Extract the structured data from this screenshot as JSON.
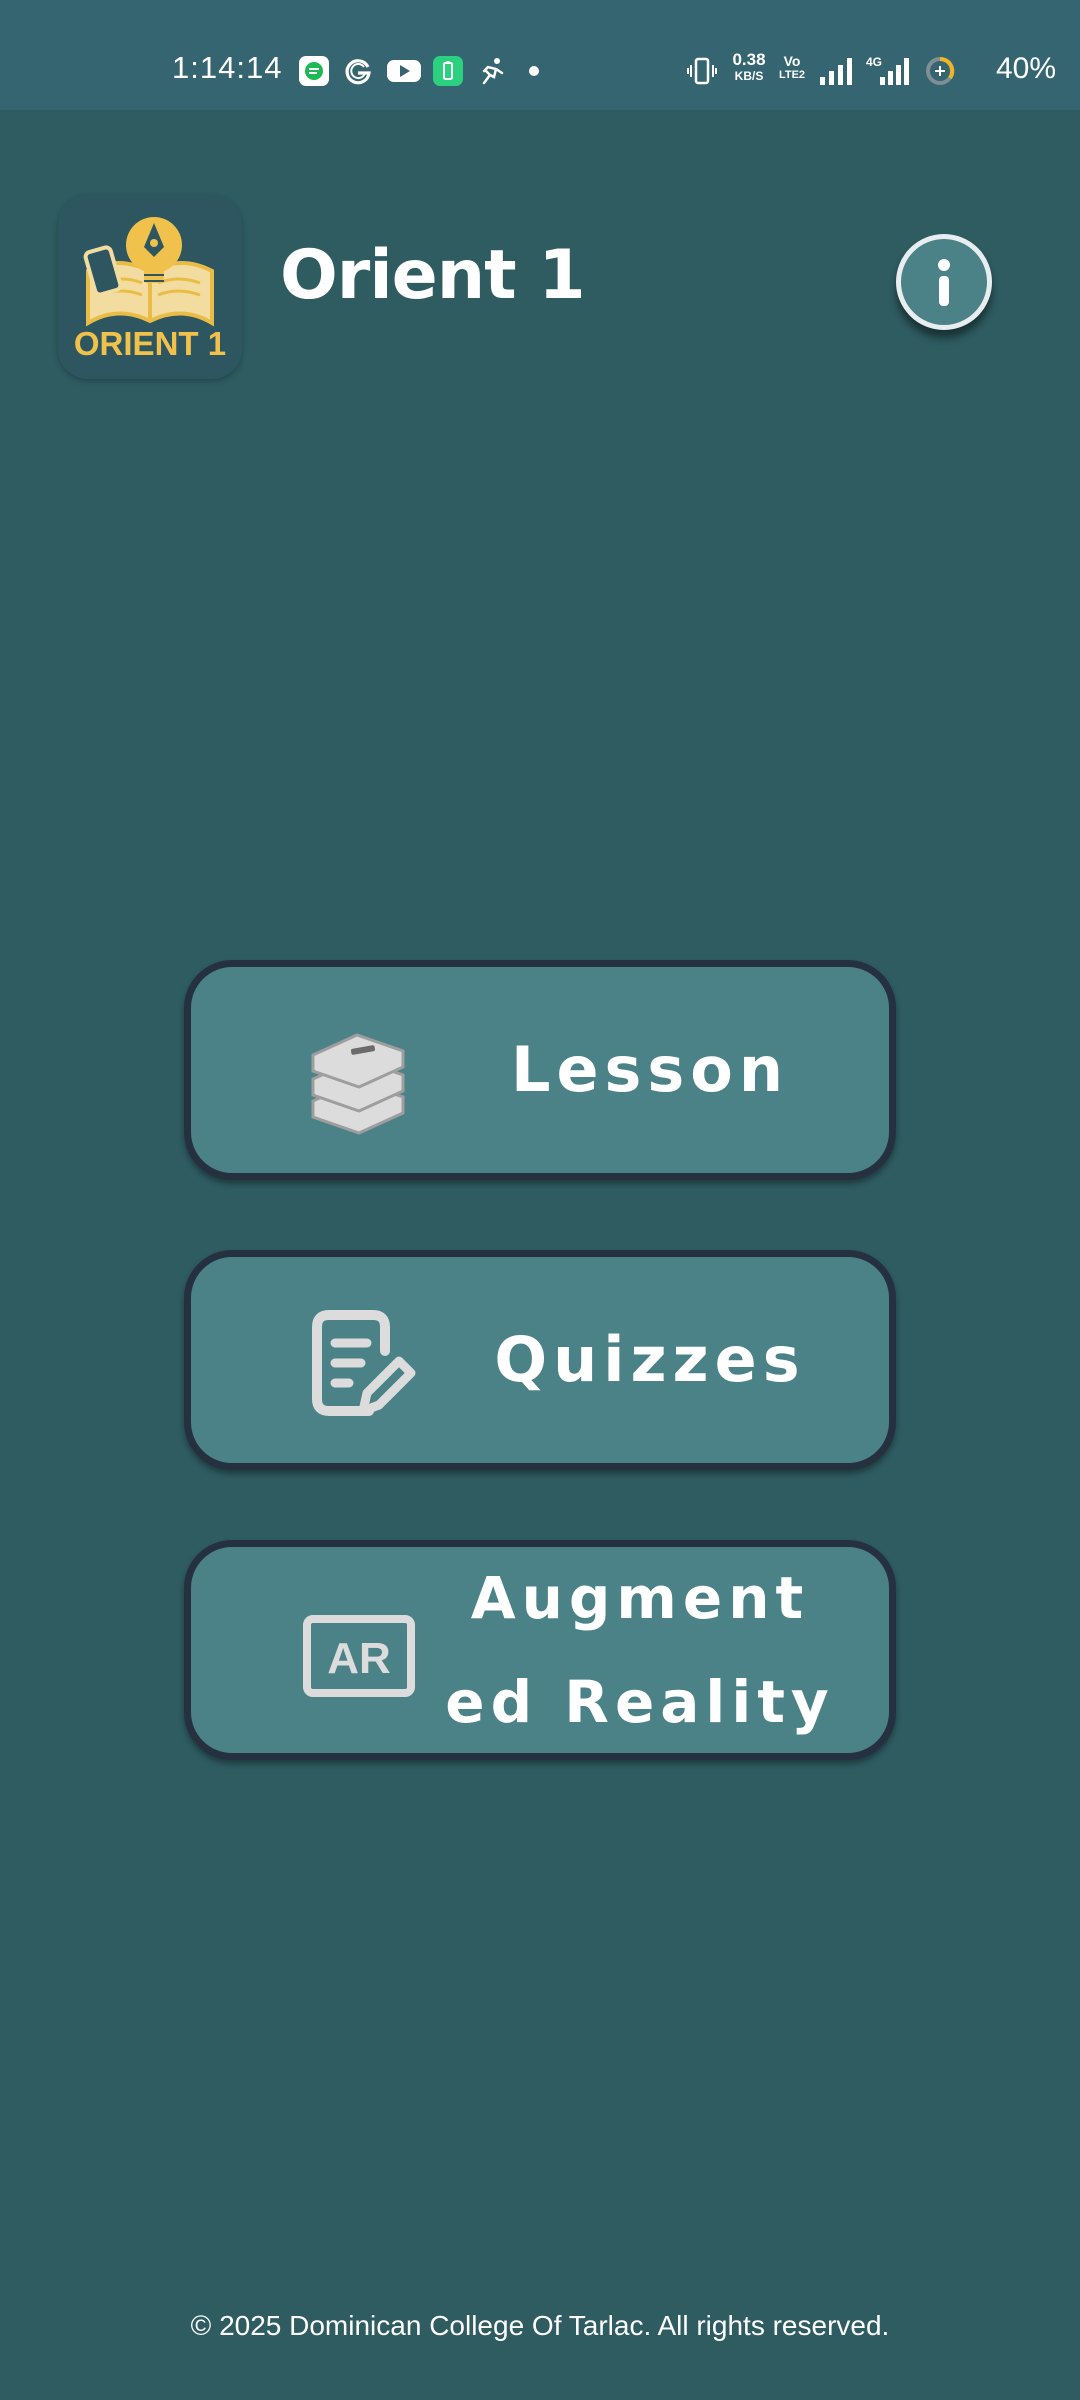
{
  "status_bar": {
    "time": "1:14:14",
    "speed_value": "0.38",
    "speed_unit": "KB/S",
    "volte_line1": "Vo",
    "volte_line2": "LTE2",
    "network": "4G",
    "battery": "40%",
    "notification_icons": [
      "chat-icon",
      "g-icon",
      "youtube-icon",
      "battery-saver-icon",
      "running-icon",
      "dot-icon"
    ]
  },
  "header": {
    "logo_text": "ORIENT 1",
    "title": "Orient 1",
    "info_icon": "info-icon"
  },
  "menu": {
    "lesson_label": "Lesson",
    "quizzes_label": "Quizzes",
    "ar_label_line1": "Augment",
    "ar_label_line2": "ed Reality",
    "ar_icon_text": "AR"
  },
  "footer": {
    "copyright": "© 2025 Dominican College Of Tarlac. All rights reserved."
  },
  "colors": {
    "background": "#2e5c61",
    "status_bar": "#356570",
    "button_fill": "#4a8287",
    "button_border": "#263140",
    "logo_accent": "#f0c24b"
  }
}
